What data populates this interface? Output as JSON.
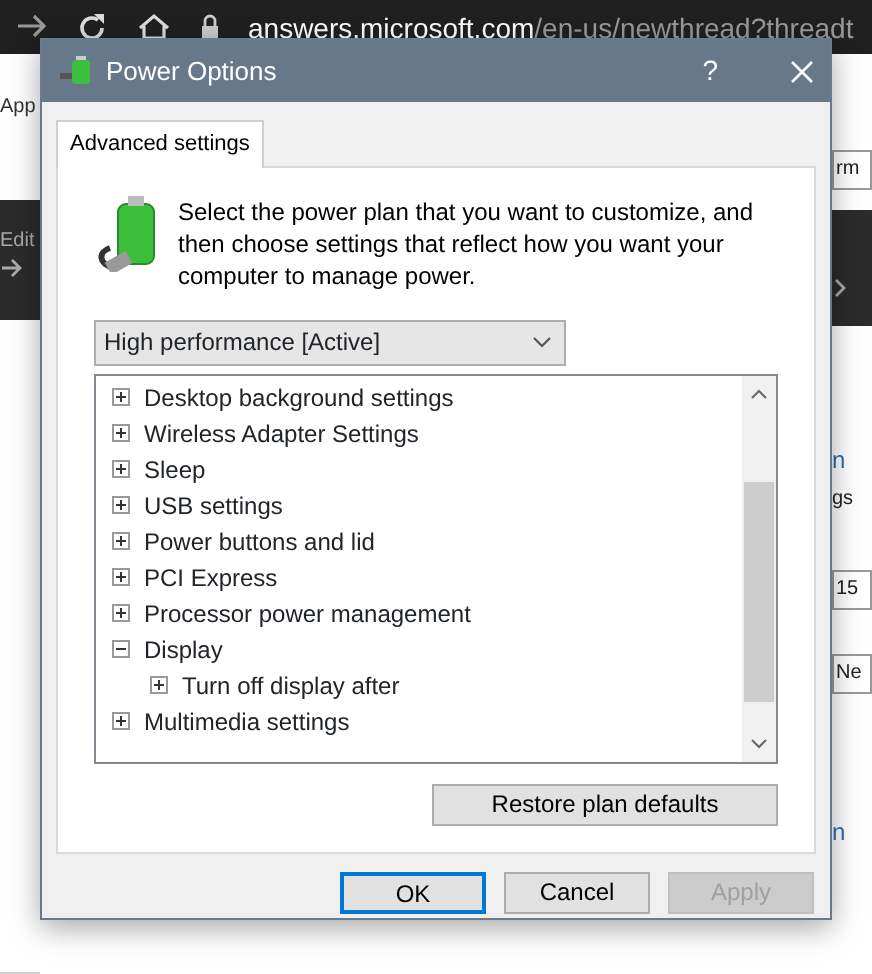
{
  "browser": {
    "address_host": "answers.microsoft.com",
    "address_path": "/en-us/newthread?threadt",
    "left_fragments": [
      {
        "text": "App",
        "kind": "light"
      },
      {
        "text": "Edit",
        "kind": "dark"
      }
    ],
    "right_fragments": [
      {
        "text": "rm",
        "kind": "field"
      },
      {
        "text": "n",
        "kind": "link"
      },
      {
        "text": "gs",
        "kind": "plain"
      },
      {
        "text": "15",
        "kind": "field"
      },
      {
        "text": "Ne",
        "kind": "field"
      },
      {
        "text": "n",
        "kind": "link"
      }
    ]
  },
  "window": {
    "title": "Power Options",
    "help": "?"
  },
  "tabs": [
    {
      "label": "Advanced settings",
      "selected": true
    }
  ],
  "description": "Select the power plan that you want to customize, and then choose settings that reflect how you want your computer to manage power.",
  "plan_dropdown": {
    "value": "High performance [Active]"
  },
  "settings_tree": [
    {
      "label": "Desktop background settings",
      "expanded": false
    },
    {
      "label": "Wireless Adapter Settings",
      "expanded": false
    },
    {
      "label": "Sleep",
      "expanded": false
    },
    {
      "label": "USB settings",
      "expanded": false
    },
    {
      "label": "Power buttons and lid",
      "expanded": false
    },
    {
      "label": "PCI Express",
      "expanded": false
    },
    {
      "label": "Processor power management",
      "expanded": false
    },
    {
      "label": "Display",
      "expanded": true,
      "children": [
        {
          "label": "Turn off display after",
          "expanded": false
        }
      ]
    },
    {
      "label": "Multimedia settings",
      "expanded": false
    }
  ],
  "restore_button": {
    "label": "Restore plan defaults"
  },
  "buttons": [
    {
      "label": "OK",
      "kind": "default",
      "disabled": false
    },
    {
      "label": "Cancel",
      "kind": "normal",
      "disabled": false
    },
    {
      "label": "Apply",
      "kind": "normal",
      "disabled": true
    }
  ]
}
